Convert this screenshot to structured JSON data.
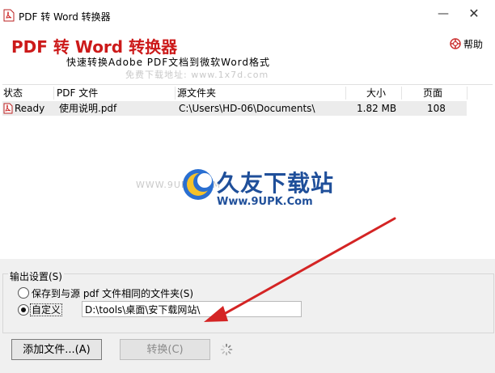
{
  "window": {
    "title": "PDF 转 Word 转换器",
    "min_glyph": "—",
    "close_glyph": "✕"
  },
  "header": {
    "app_title": "PDF 转 Word 转换器",
    "subtitle": "快速转换Adobe PDF文档到微软Word格式",
    "help_label": "帮助",
    "watermark_text": "免费下载地址: www.1x7d.com"
  },
  "filelist": {
    "columns": [
      "状态",
      "PDF 文件",
      "源文件夹",
      "大小",
      "页面"
    ],
    "rows": [
      {
        "status": "Ready",
        "file": "使用说明.pdf",
        "folder": "C:\\Users\\HD-06\\Documents\\",
        "size": "1.82 MB",
        "pages": "108"
      }
    ]
  },
  "overlay_watermark": {
    "name_cn": "久友下载站",
    "url": "Www.9UPK.Com",
    "side_text": "WWW.9UPK.COM"
  },
  "output": {
    "group_label": "输出设置(S)",
    "option_same_folder": "保存到与源 pdf 文件相同的文件夹(S)",
    "option_custom": "自定义",
    "custom_path": "D:\\tools\\桌面\\安下载网站\\",
    "selected": "custom"
  },
  "buttons": {
    "add_files": "添加文件...(A)",
    "convert": "转换(C)"
  },
  "colors": {
    "title_red": "#cc1a1a",
    "selected_row": "#ececec",
    "watermark_blue": "#1f4f9a",
    "arrow_red": "#d42424"
  }
}
